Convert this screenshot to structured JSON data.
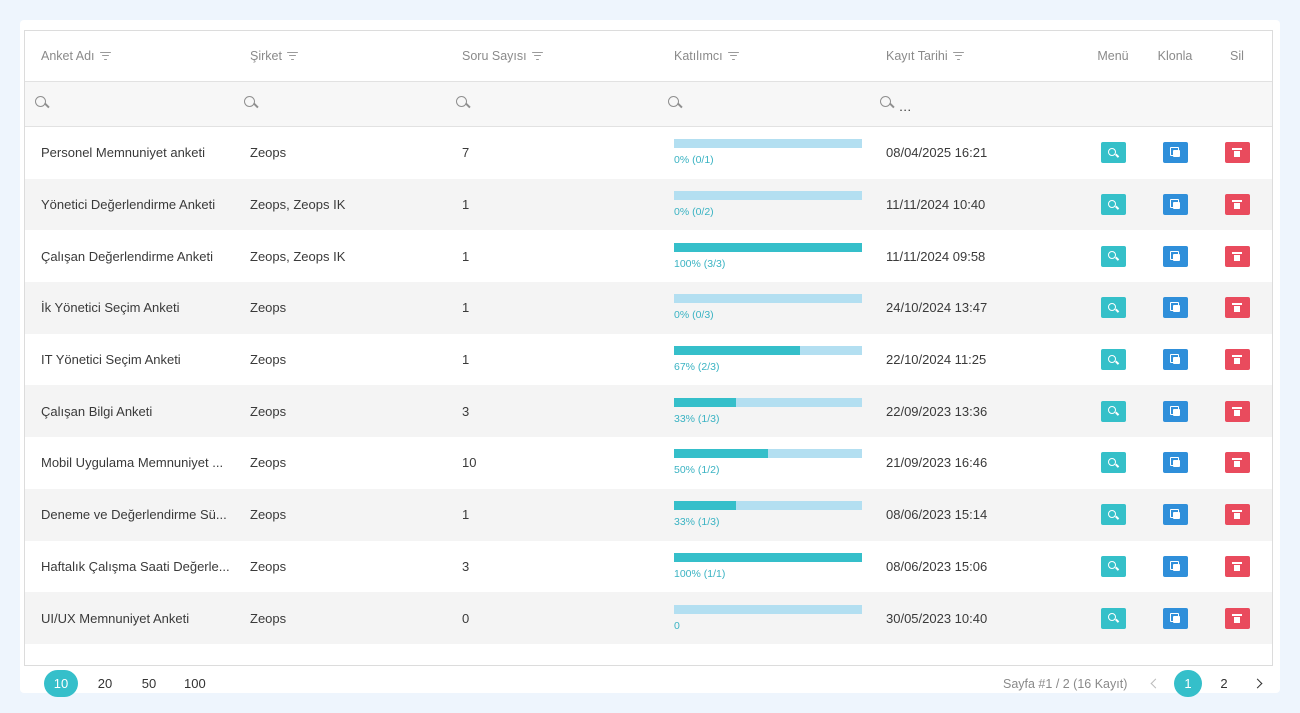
{
  "columns": {
    "name": "Anket Adı",
    "company": "Şirket",
    "count": "Soru Sayısı",
    "participant": "Katılımcı",
    "date": "Kayıt Tarihi",
    "menu": "Menü",
    "clone": "Klonla",
    "delete": "Sil"
  },
  "rows": [
    {
      "name": "Personel Memnuniyet anketi",
      "company": "Zeops",
      "count": "7",
      "progress": 0,
      "participant_label": "0% (0/1)",
      "date": "08/04/2025 16:21"
    },
    {
      "name": "Yönetici Değerlendirme Anketi",
      "company": "Zeops, Zeops IK",
      "count": "1",
      "progress": 0,
      "participant_label": "0% (0/2)",
      "date": "11/11/2024 10:40"
    },
    {
      "name": "Çalışan Değerlendirme Anketi",
      "company": "Zeops, Zeops IK",
      "count": "1",
      "progress": 100,
      "participant_label": "100% (3/3)",
      "date": "11/11/2024 09:58"
    },
    {
      "name": "İk Yönetici Seçim Anketi",
      "company": "Zeops",
      "count": "1",
      "progress": 0,
      "participant_label": "0% (0/3)",
      "date": "24/10/2024 13:47"
    },
    {
      "name": "IT Yönetici Seçim Anketi",
      "company": "Zeops",
      "count": "1",
      "progress": 67,
      "participant_label": "67% (2/3)",
      "date": "22/10/2024 11:25"
    },
    {
      "name": "Çalışan Bilgi Anketi",
      "company": "Zeops",
      "count": "3",
      "progress": 33,
      "participant_label": "33% (1/3)",
      "date": "22/09/2023 13:36"
    },
    {
      "name": "Mobil Uygulama Memnuniyet ...",
      "company": "Zeops",
      "count": "10",
      "progress": 50,
      "participant_label": "50% (1/2)",
      "date": "21/09/2023 16:46"
    },
    {
      "name": "Deneme ve Değerlendirme Sü...",
      "company": "Zeops",
      "count": "1",
      "progress": 33,
      "participant_label": "33% (1/3)",
      "date": "08/06/2023 15:14"
    },
    {
      "name": "Haftalık Çalışma Saati Değerle...",
      "company": "Zeops",
      "count": "3",
      "progress": 100,
      "participant_label": "100% (1/1)",
      "date": "08/06/2023 15:06"
    },
    {
      "name": "UI/UX Memnuniyet Anketi",
      "company": "Zeops",
      "count": "0",
      "progress": 0,
      "participant_label": "0",
      "date": "30/05/2023 10:40"
    }
  ],
  "pager": {
    "sizes": [
      "10",
      "20",
      "50",
      "100"
    ],
    "active_size": "10",
    "info": "Sayfa #1 / 2 (16 Kayıt)",
    "pages": [
      "1",
      "2"
    ],
    "active_page": "1"
  },
  "colors": {
    "accent": "#35bfca",
    "bar_bg": "#b3dff1",
    "menu_btn": "#35c0c9",
    "clone_btn": "#2f8fda",
    "delete_btn": "#e94b5d"
  },
  "icons": {
    "filter": "filter-icon",
    "search": "search-icon",
    "menu": "zoom-icon",
    "clone": "clone-icon",
    "delete": "trash-icon"
  }
}
